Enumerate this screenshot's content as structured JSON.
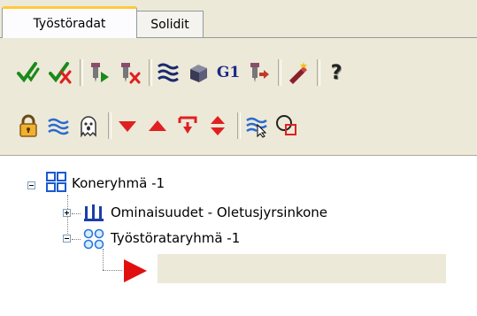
{
  "tabs": [
    {
      "label": "Työstöradat",
      "active": true
    },
    {
      "label": "Solidit",
      "active": false
    }
  ],
  "toolbar": {
    "row1": [
      "check-all-icon",
      "check-clear-icon",
      "tool-play-icon",
      "tool-delete-icon",
      "wave-pattern-icon",
      "stock-box-icon",
      "g1-code-icon",
      "tool-export-icon",
      "magic-wand-icon",
      "help-icon"
    ],
    "g1_text": "G1",
    "help_text": "?",
    "row2": [
      "lock-icon",
      "waves-icon",
      "ghost-icon",
      "arrow-down-icon",
      "arrow-up-icon",
      "move-to-icon",
      "expand-collapse-icon",
      "select-waves-icon",
      "circle-square-icon"
    ]
  },
  "tree": {
    "root": {
      "label": "Koneryhmä -1"
    },
    "properties": {
      "label": "Ominaisuudet - Oletusjyrsinkone"
    },
    "toolpath_group": {
      "label": "Työstörataryhmä -1"
    }
  },
  "colors": {
    "accent": "#ffc83c",
    "panel": "#ece9d8",
    "red": "#e02020",
    "blue": "#1a3fa8"
  }
}
